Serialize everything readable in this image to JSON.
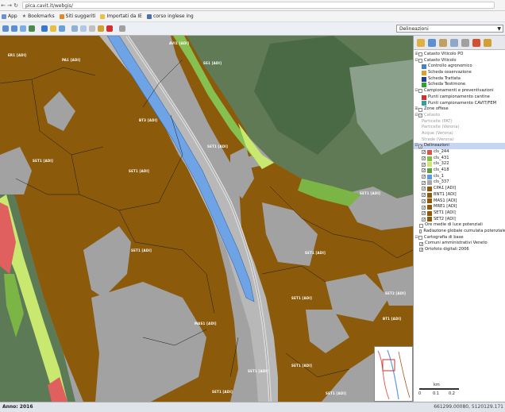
{
  "browser": {
    "url": "pica.cavit.it/webgis/",
    "bookmarks": [
      "App",
      "Bookmarks",
      "Siti suggeriti",
      "Importati da IE",
      "corso inglese ing"
    ]
  },
  "toolbar": {
    "layer_select_value": "Delineazioni",
    "tools": [
      "zoom-in-icon",
      "zoom-out-icon",
      "zoom-box-icon",
      "zoom-full-icon",
      "pan-icon",
      "identify-icon",
      "measure-icon",
      "measure-area-icon",
      "select-icon",
      "print-icon",
      "close-icon",
      "info-icon"
    ]
  },
  "map": {
    "labels": [
      {
        "text": "ER1 [ADI]"
      },
      {
        "text": "PA1 [ADI]"
      },
      {
        "text": "AVI1 [ADI]"
      },
      {
        "text": "SE1 [ADI]"
      },
      {
        "text": "BT3 [ADI]"
      },
      {
        "text": "SET1 [ADI]"
      },
      {
        "text": "SET1 [ADI]"
      },
      {
        "text": "SET1 [ADI]"
      },
      {
        "text": "SET1 [ADI]"
      },
      {
        "text": "SET1 [ADI]"
      },
      {
        "text": "SET1 [ADI]"
      },
      {
        "text": "SET2 [ADI]"
      },
      {
        "text": "MAS1 [ADI]"
      },
      {
        "text": "SET1 [ADI]"
      },
      {
        "text": "BT1 [ADI]"
      },
      {
        "text": "SET1 [ADI]"
      },
      {
        "text": "SET1 [ADI]"
      },
      {
        "text": "SET1 [ADI]"
      },
      {
        "text": "SET1 [ADI]"
      }
    ]
  },
  "layers": {
    "items": [
      {
        "label": "Catasto Viticolo PO",
        "type": "group",
        "checked": false,
        "expand": "+",
        "grey": false
      },
      {
        "label": "Catasto Viticolo",
        "type": "group",
        "checked": false,
        "expand": "-",
        "grey": false
      },
      {
        "label": "Controllo agronomico",
        "type": "swatch",
        "color": "#4a7fd0",
        "grey": false
      },
      {
        "label": "Scheda osservazione",
        "type": "swatch",
        "color": "#e0a020",
        "grey": false
      },
      {
        "label": "Scheda Trattata",
        "type": "swatch",
        "color": "#2040a0",
        "grey": false
      },
      {
        "label": "Scheda Testimone",
        "type": "swatch",
        "color": "#30a030",
        "grey": false
      },
      {
        "label": "Campionamenti e preventivazioni",
        "type": "group",
        "checked": false,
        "expand": "-",
        "grey": false
      },
      {
        "label": "Punti campionamento cantine",
        "type": "swatch",
        "color": "#d03030",
        "grey": false
      },
      {
        "label": "Punti campionamento CAVIT/FEM",
        "type": "swatch",
        "color": "#30a0a0",
        "grey": false
      },
      {
        "label": "Zone offese",
        "type": "group",
        "checked": false,
        "expand": "+",
        "grey": false
      },
      {
        "label": "Catasto",
        "type": "group",
        "checked": true,
        "expand": "-",
        "grey": true
      },
      {
        "label": "Particelle (PAT)",
        "type": "plain",
        "grey": true
      },
      {
        "label": "Particelle (Verona)",
        "type": "plain",
        "grey": true
      },
      {
        "label": "Acque (Verona)",
        "type": "plain",
        "grey": true
      },
      {
        "label": "Strade (Verona)",
        "type": "plain",
        "grey": true
      },
      {
        "label": "Delineazioni",
        "type": "group",
        "checked": true,
        "expand": "-",
        "grey": false,
        "highlight": true
      },
      {
        "label": "cls_244",
        "type": "layer",
        "color": "#e05050",
        "grey": false
      },
      {
        "label": "cls_431",
        "type": "layer",
        "color": "#80c040",
        "grey": false
      },
      {
        "label": "cls_322",
        "type": "layer",
        "color": "#c8e870",
        "grey": false
      },
      {
        "label": "cls_418",
        "type": "layer",
        "color": "#60a040",
        "grey": false
      },
      {
        "label": "cls_1",
        "type": "layer",
        "color": "#5a9ce0",
        "grey": false
      },
      {
        "label": "cls_337",
        "type": "layer",
        "color": "#a8a8a8",
        "grey": false
      },
      {
        "label": "CPA1 [ADI]",
        "type": "layer",
        "color": "#8b5a0a",
        "grey": false
      },
      {
        "label": "BNT1 [ADI]",
        "type": "layer",
        "color": "#8b5a0a",
        "grey": false
      },
      {
        "label": "MAS1 [ADI]",
        "type": "layer",
        "color": "#8b5a0a",
        "grey": false
      },
      {
        "label": "MRE1 [ADI]",
        "type": "layer",
        "color": "#8b5a0a",
        "grey": false
      },
      {
        "label": "SET1 [ADI]",
        "type": "layer",
        "color": "#8b5a0a",
        "grey": false
      },
      {
        "label": "SET2 [ADI]",
        "type": "layer",
        "color": "#8b5a0a",
        "grey": false
      },
      {
        "label": "Ore medie di luce potenziali",
        "type": "check",
        "checked": false,
        "grey": false
      },
      {
        "label": "Radiazione globale cumulata potenziale",
        "type": "check",
        "checked": false,
        "grey": false
      },
      {
        "label": "Cartografia di base",
        "type": "group",
        "checked": false,
        "expand": "-",
        "grey": false
      },
      {
        "label": "Comuni amministrativi Veneto",
        "type": "check",
        "checked": true,
        "grey": false
      },
      {
        "label": "Ortofoto digitali 2006",
        "type": "check",
        "checked": true,
        "grey": false
      }
    ]
  },
  "scale": {
    "unit_label": "km",
    "ticks": [
      "0",
      "0.1",
      "0.2"
    ]
  },
  "status": {
    "year_label": "Anno: 2016",
    "coordinates": "661299.00080, 5120129.171"
  }
}
